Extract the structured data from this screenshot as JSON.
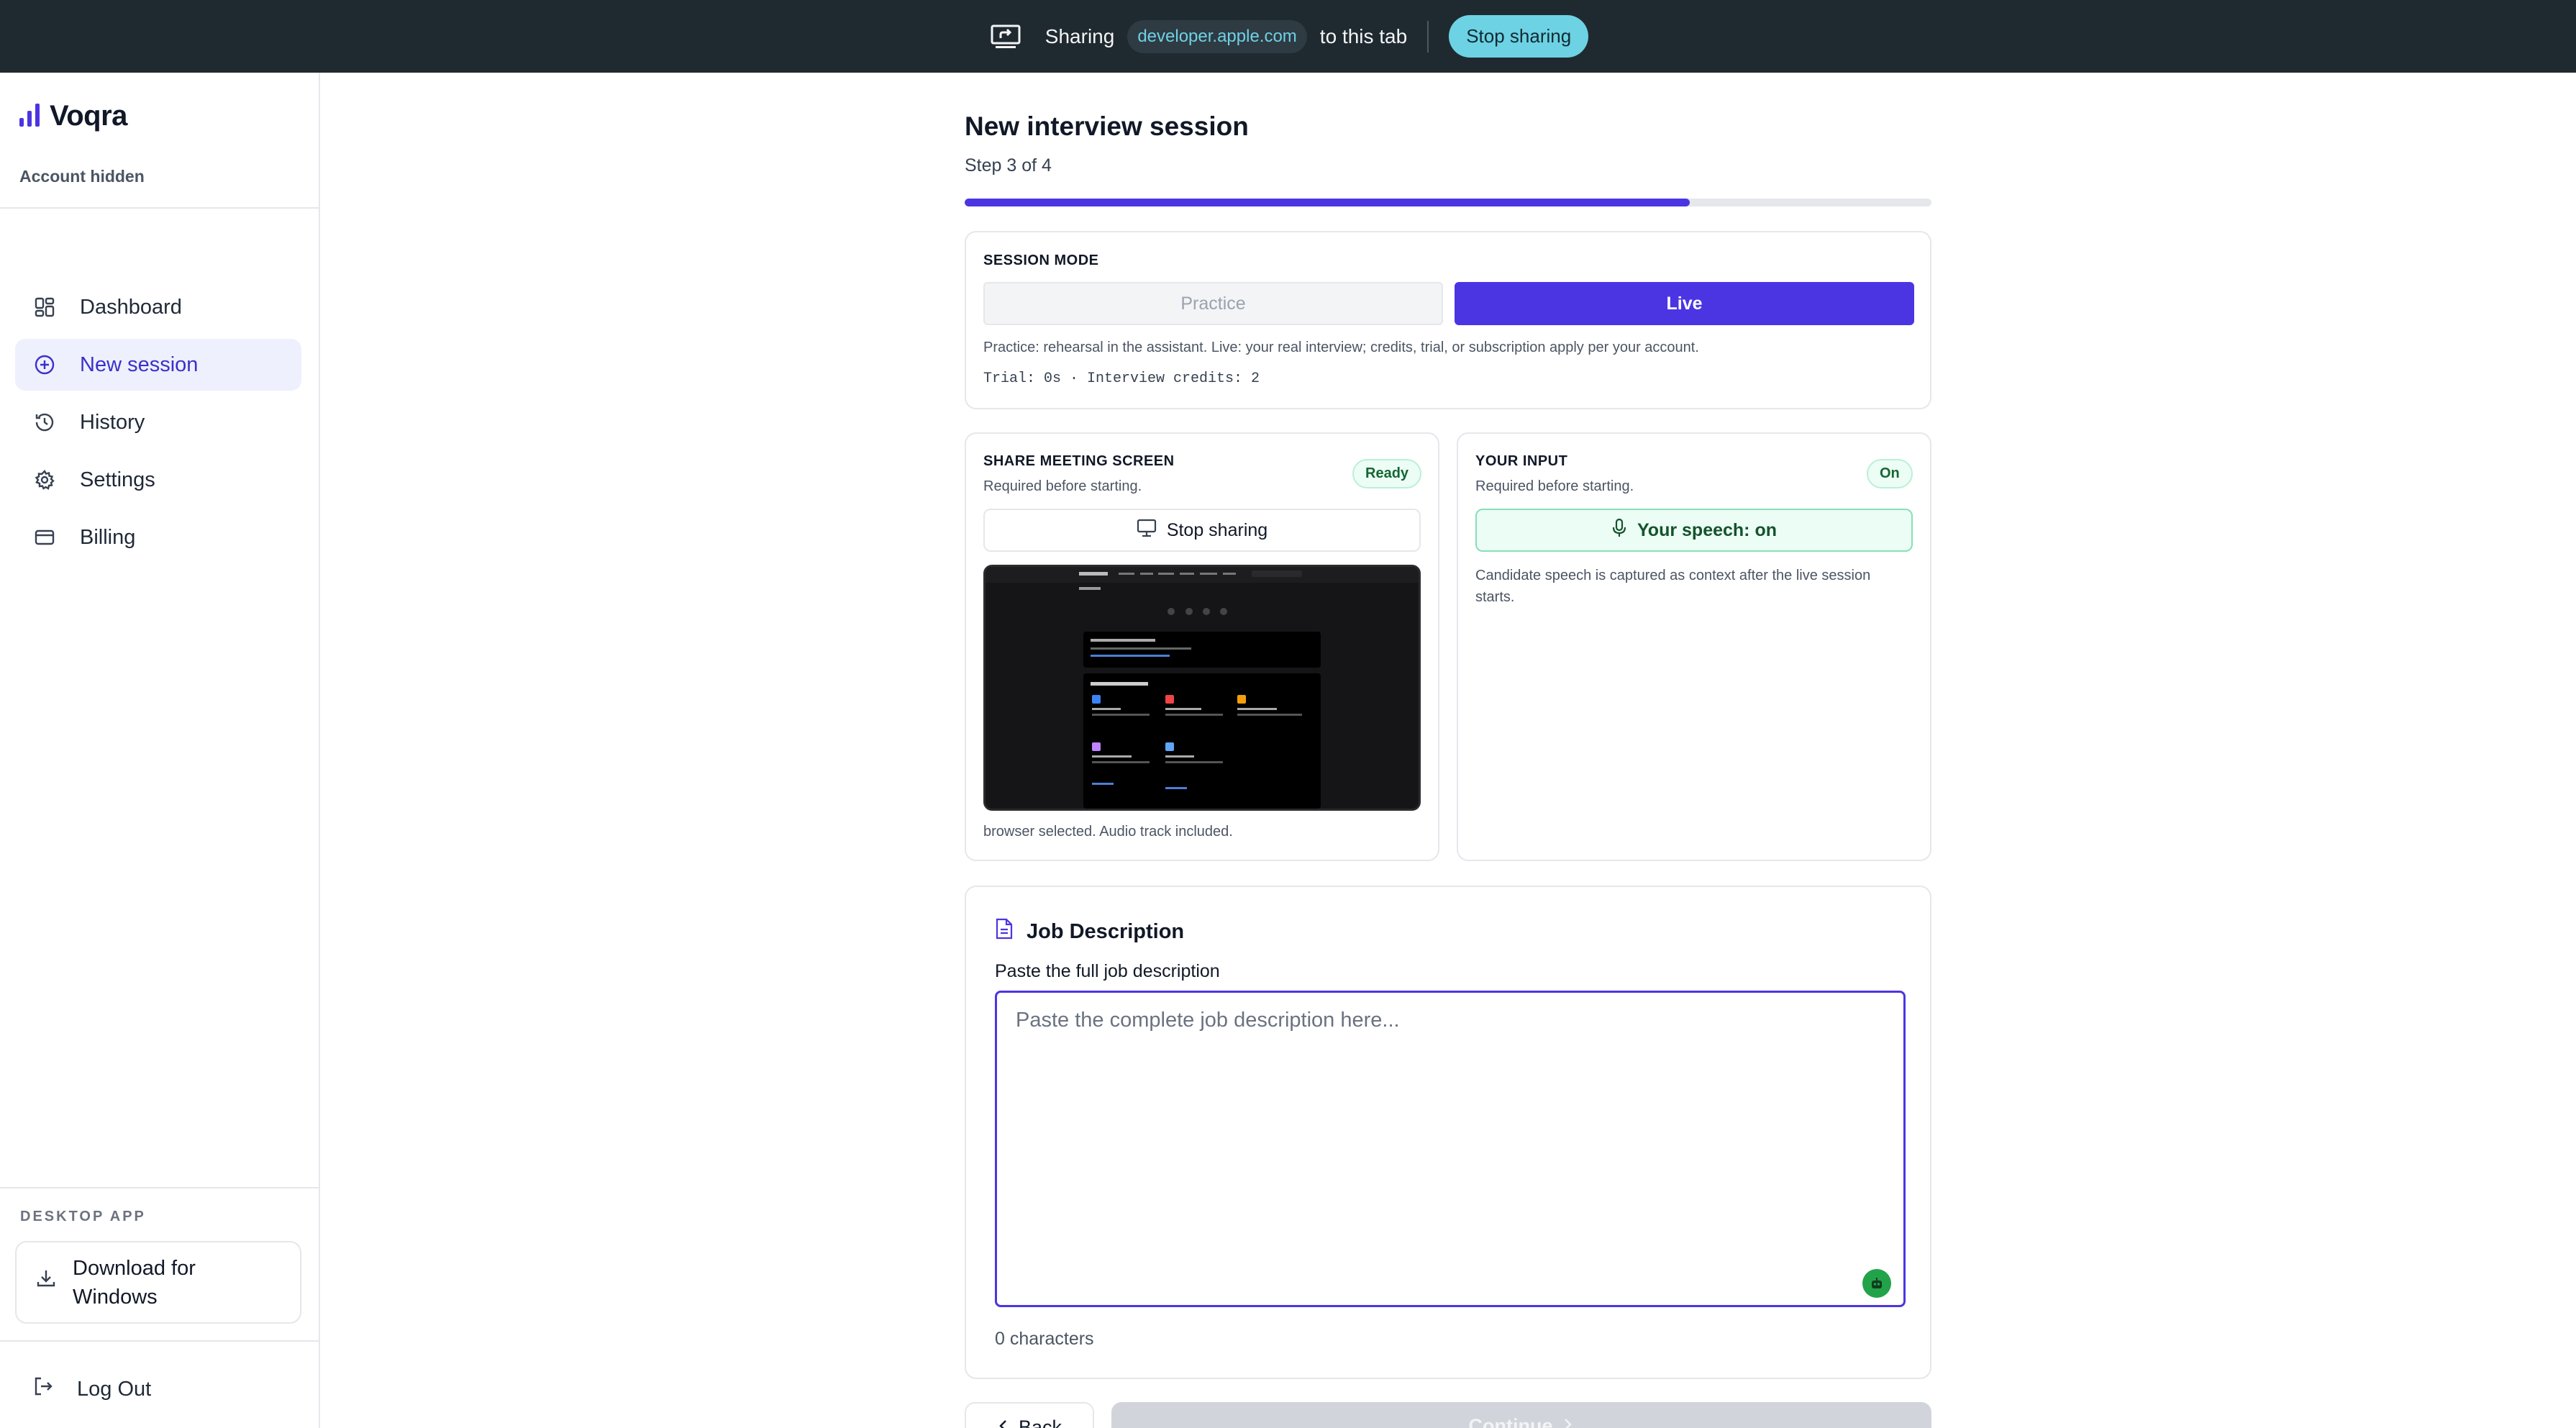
{
  "share_bar": {
    "sharing_label": "Sharing",
    "domain": "developer.apple.com",
    "suffix": "to this tab",
    "stop_label": "Stop sharing"
  },
  "sidebar": {
    "brand": "Voqra",
    "account": "Account hidden",
    "nav": [
      {
        "label": "Dashboard",
        "icon": "dashboard-icon",
        "active": false
      },
      {
        "label": "New session",
        "icon": "plus-circle-icon",
        "active": true
      },
      {
        "label": "History",
        "icon": "history-icon",
        "active": false
      },
      {
        "label": "Settings",
        "icon": "gear-icon",
        "active": false
      },
      {
        "label": "Billing",
        "icon": "credit-card-icon",
        "active": false
      }
    ],
    "desktop_label": "DESKTOP APP",
    "download_label": "Download for Windows",
    "logout_label": "Log Out"
  },
  "main": {
    "title": "New interview session",
    "step": "Step 3 of 4",
    "progress": 0.75
  },
  "session_mode": {
    "label": "SESSION MODE",
    "options": [
      "Practice",
      "Live"
    ],
    "selected": "Live",
    "description": "Practice: rehearsal in the assistant. Live: your real interview; credits, trial, or subscription apply per your account.",
    "credits": "Trial: 0s · Interview credits: 2"
  },
  "share_screen": {
    "label": "SHARE MEETING SCREEN",
    "sub": "Required before starting.",
    "badge": "Ready",
    "button": "Stop sharing",
    "footer": "browser selected. Audio track included."
  },
  "your_input": {
    "label": "YOUR INPUT",
    "sub": "Required before starting.",
    "badge": "On",
    "button": "Your speech: on",
    "description": "Candidate speech is captured as context after the live session starts."
  },
  "job_description": {
    "title": "Job Description",
    "label": "Paste the full job description",
    "placeholder": "Paste the complete job description here...",
    "value": "",
    "count": "0 characters"
  },
  "footer_buttons": {
    "back": "Back",
    "continue": "Continue"
  },
  "colors": {
    "accent": "#4b35e3",
    "share_bar_bg": "#1f2a30",
    "share_button": "#6dd2e3",
    "ready_green": "#166534"
  }
}
